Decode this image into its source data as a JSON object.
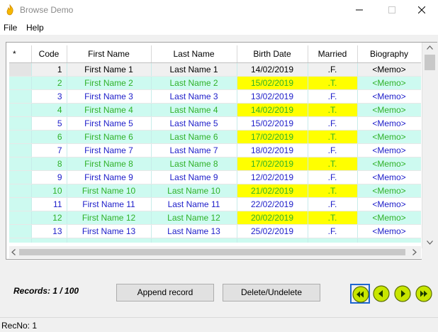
{
  "window": {
    "title": "Browse Demo",
    "icon": "flame-icon"
  },
  "menu": {
    "items": [
      {
        "label": "File"
      },
      {
        "label": "Help"
      }
    ]
  },
  "grid": {
    "columns": [
      "*",
      "Code",
      "First Name",
      "Last Name",
      "Birth Date",
      "Married",
      "Biography"
    ],
    "rows": [
      {
        "code": "1",
        "first": "First Name 1",
        "last": "Last Name 1",
        "birth": "14/02/2019",
        "married": ".F.",
        "bio": "<Memo>"
      },
      {
        "code": "2",
        "first": "First Name 2",
        "last": "Last Name 2",
        "birth": "15/02/2019",
        "married": ".T.",
        "bio": "<Memo>"
      },
      {
        "code": "3",
        "first": "First Name 3",
        "last": "Last Name 3",
        "birth": "13/02/2019",
        "married": ".F.",
        "bio": "<Memo>"
      },
      {
        "code": "4",
        "first": "First Name 4",
        "last": "Last Name 4",
        "birth": "14/02/2019",
        "married": ".T.",
        "bio": "<Memo>"
      },
      {
        "code": "5",
        "first": "First Name 5",
        "last": "Last Name 5",
        "birth": "15/02/2019",
        "married": ".F.",
        "bio": "<Memo>"
      },
      {
        "code": "6",
        "first": "First Name 6",
        "last": "Last Name 6",
        "birth": "17/02/2019",
        "married": ".T.",
        "bio": "<Memo>"
      },
      {
        "code": "7",
        "first": "First Name 7",
        "last": "Last Name 7",
        "birth": "18/02/2019",
        "married": ".F.",
        "bio": "<Memo>"
      },
      {
        "code": "8",
        "first": "First Name 8",
        "last": "Last Name 8",
        "birth": "17/02/2019",
        "married": ".T.",
        "bio": "<Memo>"
      },
      {
        "code": "9",
        "first": "First Name 9",
        "last": "Last Name 9",
        "birth": "12/02/2019",
        "married": ".F.",
        "bio": "<Memo>"
      },
      {
        "code": "10",
        "first": "First Name 10",
        "last": "Last Name 10",
        "birth": "21/02/2019",
        "married": ".T.",
        "bio": "<Memo>"
      },
      {
        "code": "11",
        "first": "First Name 11",
        "last": "Last Name 11",
        "birth": "22/02/2019",
        "married": ".F.",
        "bio": "<Memo>"
      },
      {
        "code": "12",
        "first": "First Name 12",
        "last": "Last Name 12",
        "birth": "20/02/2019",
        "married": ".T.",
        "bio": "<Memo>"
      },
      {
        "code": "13",
        "first": "First Name 13",
        "last": "Last Name 13",
        "birth": "25/02/2019",
        "married": ".F.",
        "bio": "<Memo>"
      }
    ]
  },
  "footer": {
    "records_label": "Records:  1 / 100",
    "append_label": "Append record",
    "delete_label": "Delete/Undelete",
    "nav": [
      "first-record-icon",
      "prev-record-icon",
      "next-record-icon",
      "last-record-icon"
    ]
  },
  "status": {
    "text": "RecNo: 1"
  },
  "colors": {
    "odd_row_text": "#1c1cc9",
    "even_row_text": "#2fb128",
    "even_row_bg": "#cdfaf0",
    "highlight": "#ffff00",
    "nav_button": "#c8e600"
  }
}
